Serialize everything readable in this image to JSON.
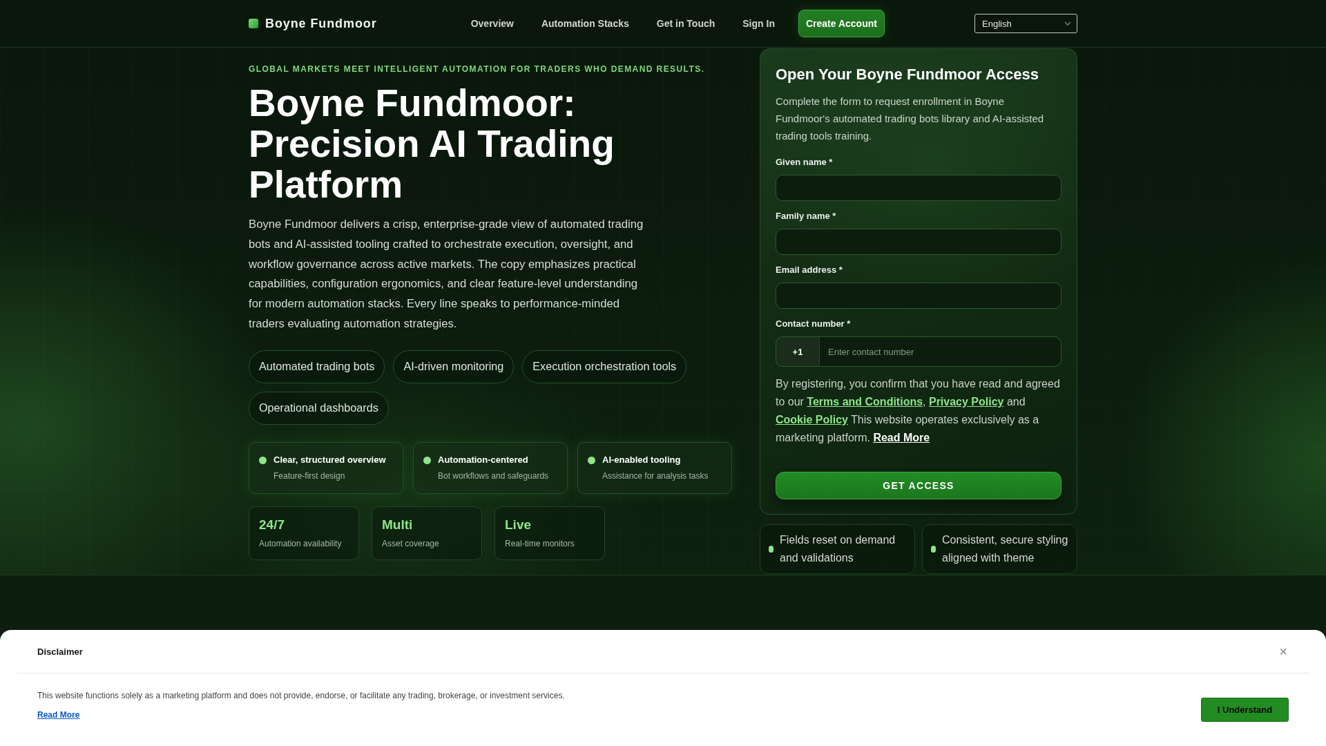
{
  "header": {
    "brand": "Boyne Fundmoor",
    "nav": [
      {
        "label": "Overview",
        "kind": "link"
      },
      {
        "label": "Automation Stacks",
        "kind": "link"
      },
      {
        "label": "Get in Touch",
        "kind": "link"
      },
      {
        "label": "Sign In",
        "kind": "link"
      },
      {
        "label": "Create Account",
        "kind": "button"
      }
    ],
    "language": "English"
  },
  "hero": {
    "tagline": "GLOBAL MARKETS MEET INTELLIGENT AUTOMATION FOR TRADERS WHO DEMAND RESULTS.",
    "heading": "Boyne Fundmoor: Precision AI Trading Platform",
    "description": "Boyne Fundmoor delivers a crisp, enterprise-grade view of automated trading bots and AI-assisted tooling crafted to orchestrate execution, oversight, and workflow governance across active markets. The copy emphasizes practical capabilities, configuration ergonomics, and clear feature-level understanding for modern automation stacks. Every line speaks to performance-minded traders evaluating automation strategies.",
    "chips": [
      "Automated trading bots",
      "AI-driven monitoring",
      "Execution orchestration tools",
      "Operational dashboards"
    ],
    "features": [
      {
        "title": "Clear, structured overview",
        "subtitle": "Feature-first design"
      },
      {
        "title": "Automation-centered",
        "subtitle": "Bot workflows and safeguards"
      },
      {
        "title": "AI-enabled tooling",
        "subtitle": "Assistance for analysis tasks"
      }
    ],
    "stats": [
      {
        "value": "24/7",
        "label": "Automation availability"
      },
      {
        "value": "Multi",
        "label": "Asset coverage"
      },
      {
        "value": "Live",
        "label": "Real-time monitors"
      }
    ]
  },
  "form": {
    "title": "Open Your Boyne Fundmoor Access",
    "description": "Complete the form to request enrollment in Boyne Fundmoor's automated trading bots library and AI-assisted trading tools training.",
    "fields": [
      {
        "kind": "text",
        "label": "Given name *"
      },
      {
        "kind": "text",
        "label": "Family name *"
      },
      {
        "kind": "text",
        "label": "Email address *"
      },
      {
        "kind": "phone",
        "label": "Contact number *",
        "prefix": "+1",
        "placeholder": "Enter contact number"
      }
    ],
    "consent": [
      {
        "kind": "text",
        "text": "By registering, you confirm that you have read and agreed to our "
      },
      {
        "kind": "policy",
        "text": "Terms and Conditions"
      },
      {
        "kind": "text",
        "text": ", "
      },
      {
        "kind": "policy",
        "text": "Privacy Policy"
      },
      {
        "kind": "text",
        "text": " and "
      },
      {
        "kind": "policy",
        "text": "Cookie Policy"
      },
      {
        "kind": "text",
        "text": " This website operates exclusively as a marketing platform. "
      },
      {
        "kind": "more",
        "text": "Read More"
      }
    ],
    "submit": "GET ACCESS"
  },
  "notes": [
    "Fields reset on demand and validations",
    "Consistent, secure styling aligned with theme"
  ],
  "disclaimer": {
    "title": "Disclaimer",
    "close": "×",
    "text": "This website functions solely as a marketing platform and does not provide, endorse, or facilitate any trading, brokerage, or investment services.",
    "link": "Read More",
    "button": "I Understand"
  }
}
